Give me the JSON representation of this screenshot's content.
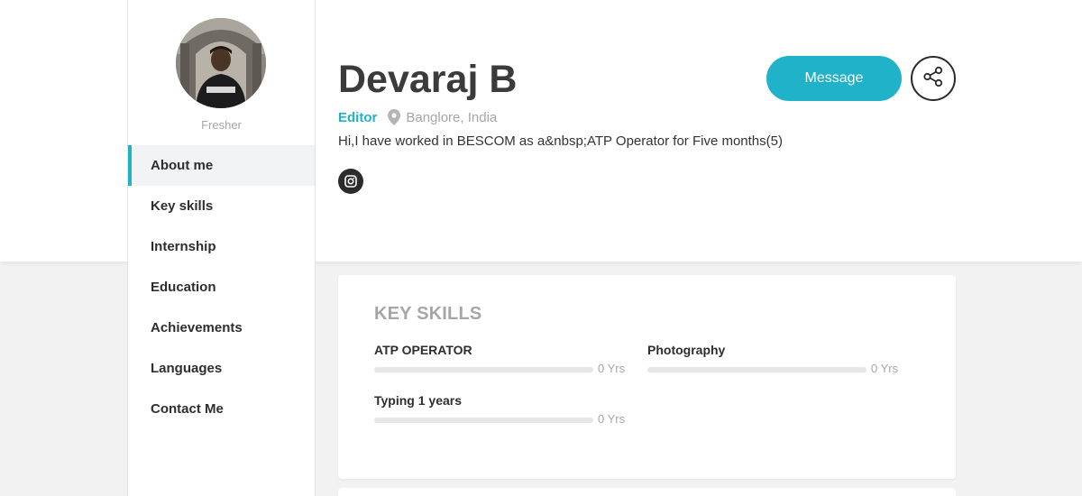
{
  "profile": {
    "name": "Devaraj B",
    "role_label": "Fresher",
    "title": "Editor",
    "location": "Banglore, India",
    "bio": "Hi,I have worked in BESCOM as a&nbsp;ATP Operator for Five months(5)",
    "social": [
      "instagram-icon"
    ]
  },
  "actions": {
    "message_label": "Message",
    "share_icon": "share-icon"
  },
  "sidebar": {
    "items": [
      {
        "label": "About me",
        "active": true
      },
      {
        "label": "Key skills"
      },
      {
        "label": "Internship"
      },
      {
        "label": "Education"
      },
      {
        "label": "Achievements"
      },
      {
        "label": "Languages"
      },
      {
        "label": "Contact Me"
      }
    ]
  },
  "key_skills": {
    "title": "KEY SKILLS",
    "skills": [
      {
        "name": "ATP OPERATOR",
        "years": "0 Yrs",
        "level": 0
      },
      {
        "name": "Photography",
        "years": "0 Yrs",
        "level": 0
      },
      {
        "name": "Typing 1 years",
        "years": "0 Yrs",
        "level": 0
      }
    ]
  },
  "colors": {
    "accent": "#1fb2c9",
    "dark": "#2b2b2b",
    "muted": "#a6a6a6"
  }
}
